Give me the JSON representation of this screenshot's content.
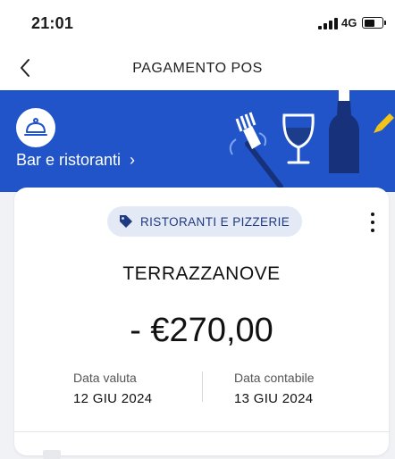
{
  "status_bar": {
    "time": "21:01",
    "network": "4G"
  },
  "header": {
    "title": "PAGAMENTO POS",
    "back_icon": "chevron-left-icon"
  },
  "banner": {
    "background_color": "#2154c9",
    "category_icon": "cloche-icon",
    "category_label": "Bar e ristoranti",
    "category_chevron": "›",
    "illustration": "fork-wine-bottle-illustration"
  },
  "transaction": {
    "tag": {
      "icon": "tag-icon",
      "label": "RISTORANTI E PIZZERIE"
    },
    "more_icon": "more-vertical-icon",
    "merchant": "TERRAZZANOVE",
    "amount": "- €270,00",
    "value_date": {
      "label": "Data valuta",
      "value": "12 GIU 2024"
    },
    "accounting_date": {
      "label": "Data contabile",
      "value": "13 GIU 2024"
    }
  },
  "colors": {
    "accent": "#2154c9",
    "tag_bg": "#e3e9f5",
    "tag_text": "#1e3a83",
    "wine": "#1c3c8c",
    "highlight": "#f2c417"
  }
}
